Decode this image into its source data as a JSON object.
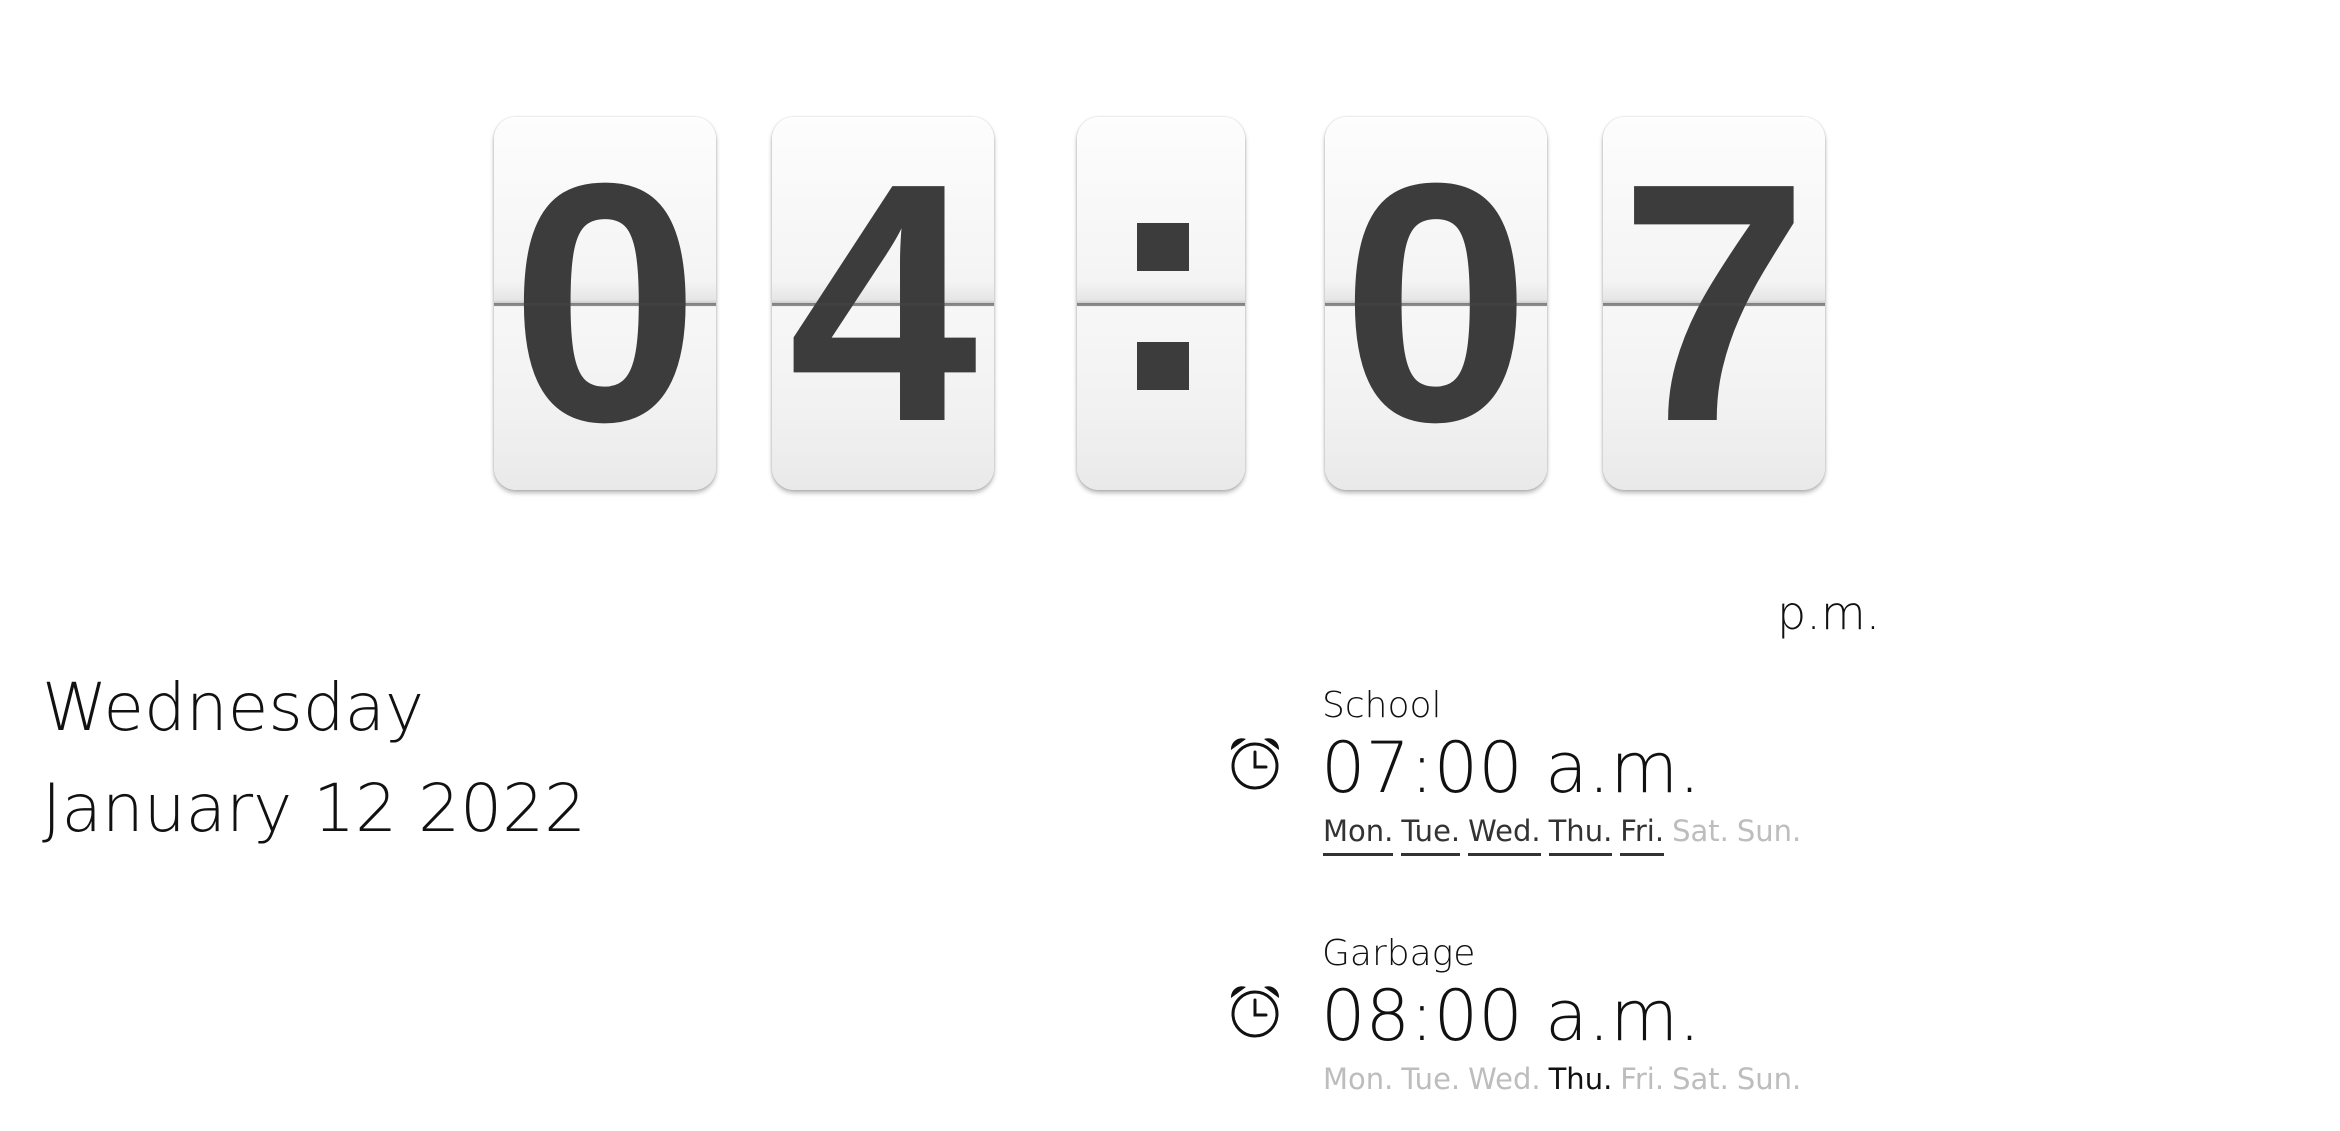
{
  "clock": {
    "digits": [
      "0",
      "4",
      "0",
      "7"
    ]
  },
  "meridiem": "p.m.",
  "date": {
    "weekday": "Wednesday",
    "full": "January 12 2022"
  },
  "alarms": [
    {
      "name": "School",
      "time": "07:00 a.m.",
      "icon": "alarm-clock-icon",
      "days": [
        {
          "label": "Mon.",
          "active": true
        },
        {
          "label": "Tue.",
          "active": true
        },
        {
          "label": "Wed.",
          "active": true
        },
        {
          "label": "Thu.",
          "active": true
        },
        {
          "label": "Fri.",
          "active": true
        },
        {
          "label": "Sat.",
          "active": false
        },
        {
          "label": "Sun.",
          "active": false
        }
      ]
    },
    {
      "name": "Garbage",
      "time": "08:00 a.m.",
      "icon": "alarm-clock-icon",
      "days": [
        {
          "label": "Mon.",
          "active": false
        },
        {
          "label": "Tue.",
          "active": false
        },
        {
          "label": "Wed.",
          "active": false
        },
        {
          "label": "Thu.",
          "active": true
        },
        {
          "label": "Fri.",
          "active": false
        },
        {
          "label": "Sat.",
          "active": false
        },
        {
          "label": "Sun.",
          "active": false
        }
      ]
    }
  ],
  "colors": {
    "digit": "#3c3c3c",
    "text": "#111111",
    "inactive_day": "#bdbdbd"
  }
}
